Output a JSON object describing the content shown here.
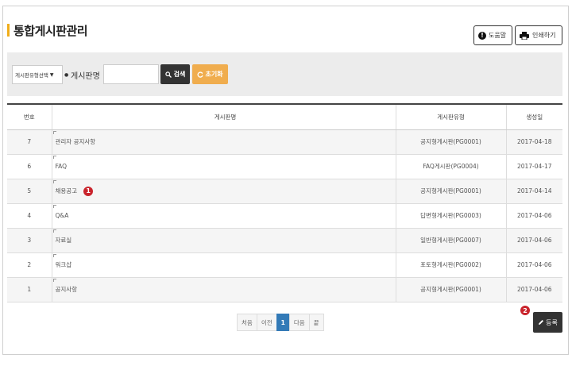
{
  "page": {
    "title": "통합게시판관리"
  },
  "top_buttons": {
    "help": "도움말",
    "print": "인쇄하기"
  },
  "search": {
    "select_value": "게시판유형선택",
    "label": "게시판명",
    "input_value": "",
    "search_button": "검색",
    "reset_button": "초기화"
  },
  "table": {
    "columns": [
      "번호",
      "게시판명",
      "게시판유형",
      "생성일"
    ],
    "rows": [
      {
        "no": "7",
        "name": "관리자 공지사항",
        "type": "공지형게시판(PG0001)",
        "date": "2017-04-18"
      },
      {
        "no": "6",
        "name": "FAQ",
        "type": "FAQ게시판(PG0004)",
        "date": "2017-04-17"
      },
      {
        "no": "5",
        "name": "채용공고",
        "type": "공지형게시판(PG0001)",
        "date": "2017-04-14"
      },
      {
        "no": "4",
        "name": "Q&A",
        "type": "답변형게시판(PG0003)",
        "date": "2017-04-06"
      },
      {
        "no": "3",
        "name": "자료실",
        "type": "일반형게시판(PG0007)",
        "date": "2017-04-06"
      },
      {
        "no": "2",
        "name": "워크샵",
        "type": "포토형게시판(PG0002)",
        "date": "2017-04-06"
      },
      {
        "no": "1",
        "name": "공지사항",
        "type": "공지형게시판(PG0001)",
        "date": "2017-04-06"
      }
    ]
  },
  "annotations": {
    "marker1": "1",
    "marker2": "2"
  },
  "pagination": {
    "first": "처음",
    "prev": "이전",
    "current": "1",
    "next": "다음",
    "last": "끝"
  },
  "register_button": "등록",
  "colors": {
    "accent": "#f0ad1a",
    "dark_button": "#333333",
    "reset_button": "#f0ad4e",
    "page_active": "#337ab7",
    "badge": "#c9242c"
  }
}
